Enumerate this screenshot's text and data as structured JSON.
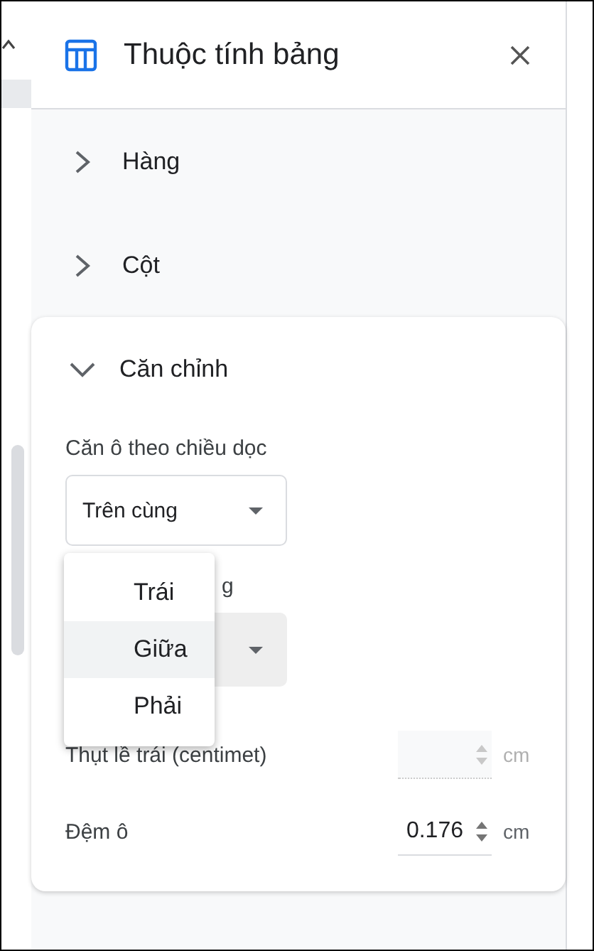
{
  "panel": {
    "title": "Thuộc tính bảng"
  },
  "sections": [
    {
      "label": "Hàng",
      "expanded": false
    },
    {
      "label": "Cột",
      "expanded": false
    },
    {
      "label": "Căn chỉnh",
      "expanded": true
    }
  ],
  "alignment": {
    "vertical_label": "Căn ô theo chiều dọc",
    "vertical_value": "Trên cùng",
    "horizontal_label": "g",
    "menu": [
      {
        "label": "Trái",
        "selected": false
      },
      {
        "label": "Giữa",
        "selected": true
      },
      {
        "label": "Phải",
        "selected": false
      }
    ],
    "fields": [
      {
        "label": "Thụt lề trái (centimet)",
        "unit": "cm",
        "disabled": true
      },
      {
        "label": "Đệm ô",
        "value": "0.176",
        "unit": "cm",
        "disabled": false
      }
    ]
  }
}
